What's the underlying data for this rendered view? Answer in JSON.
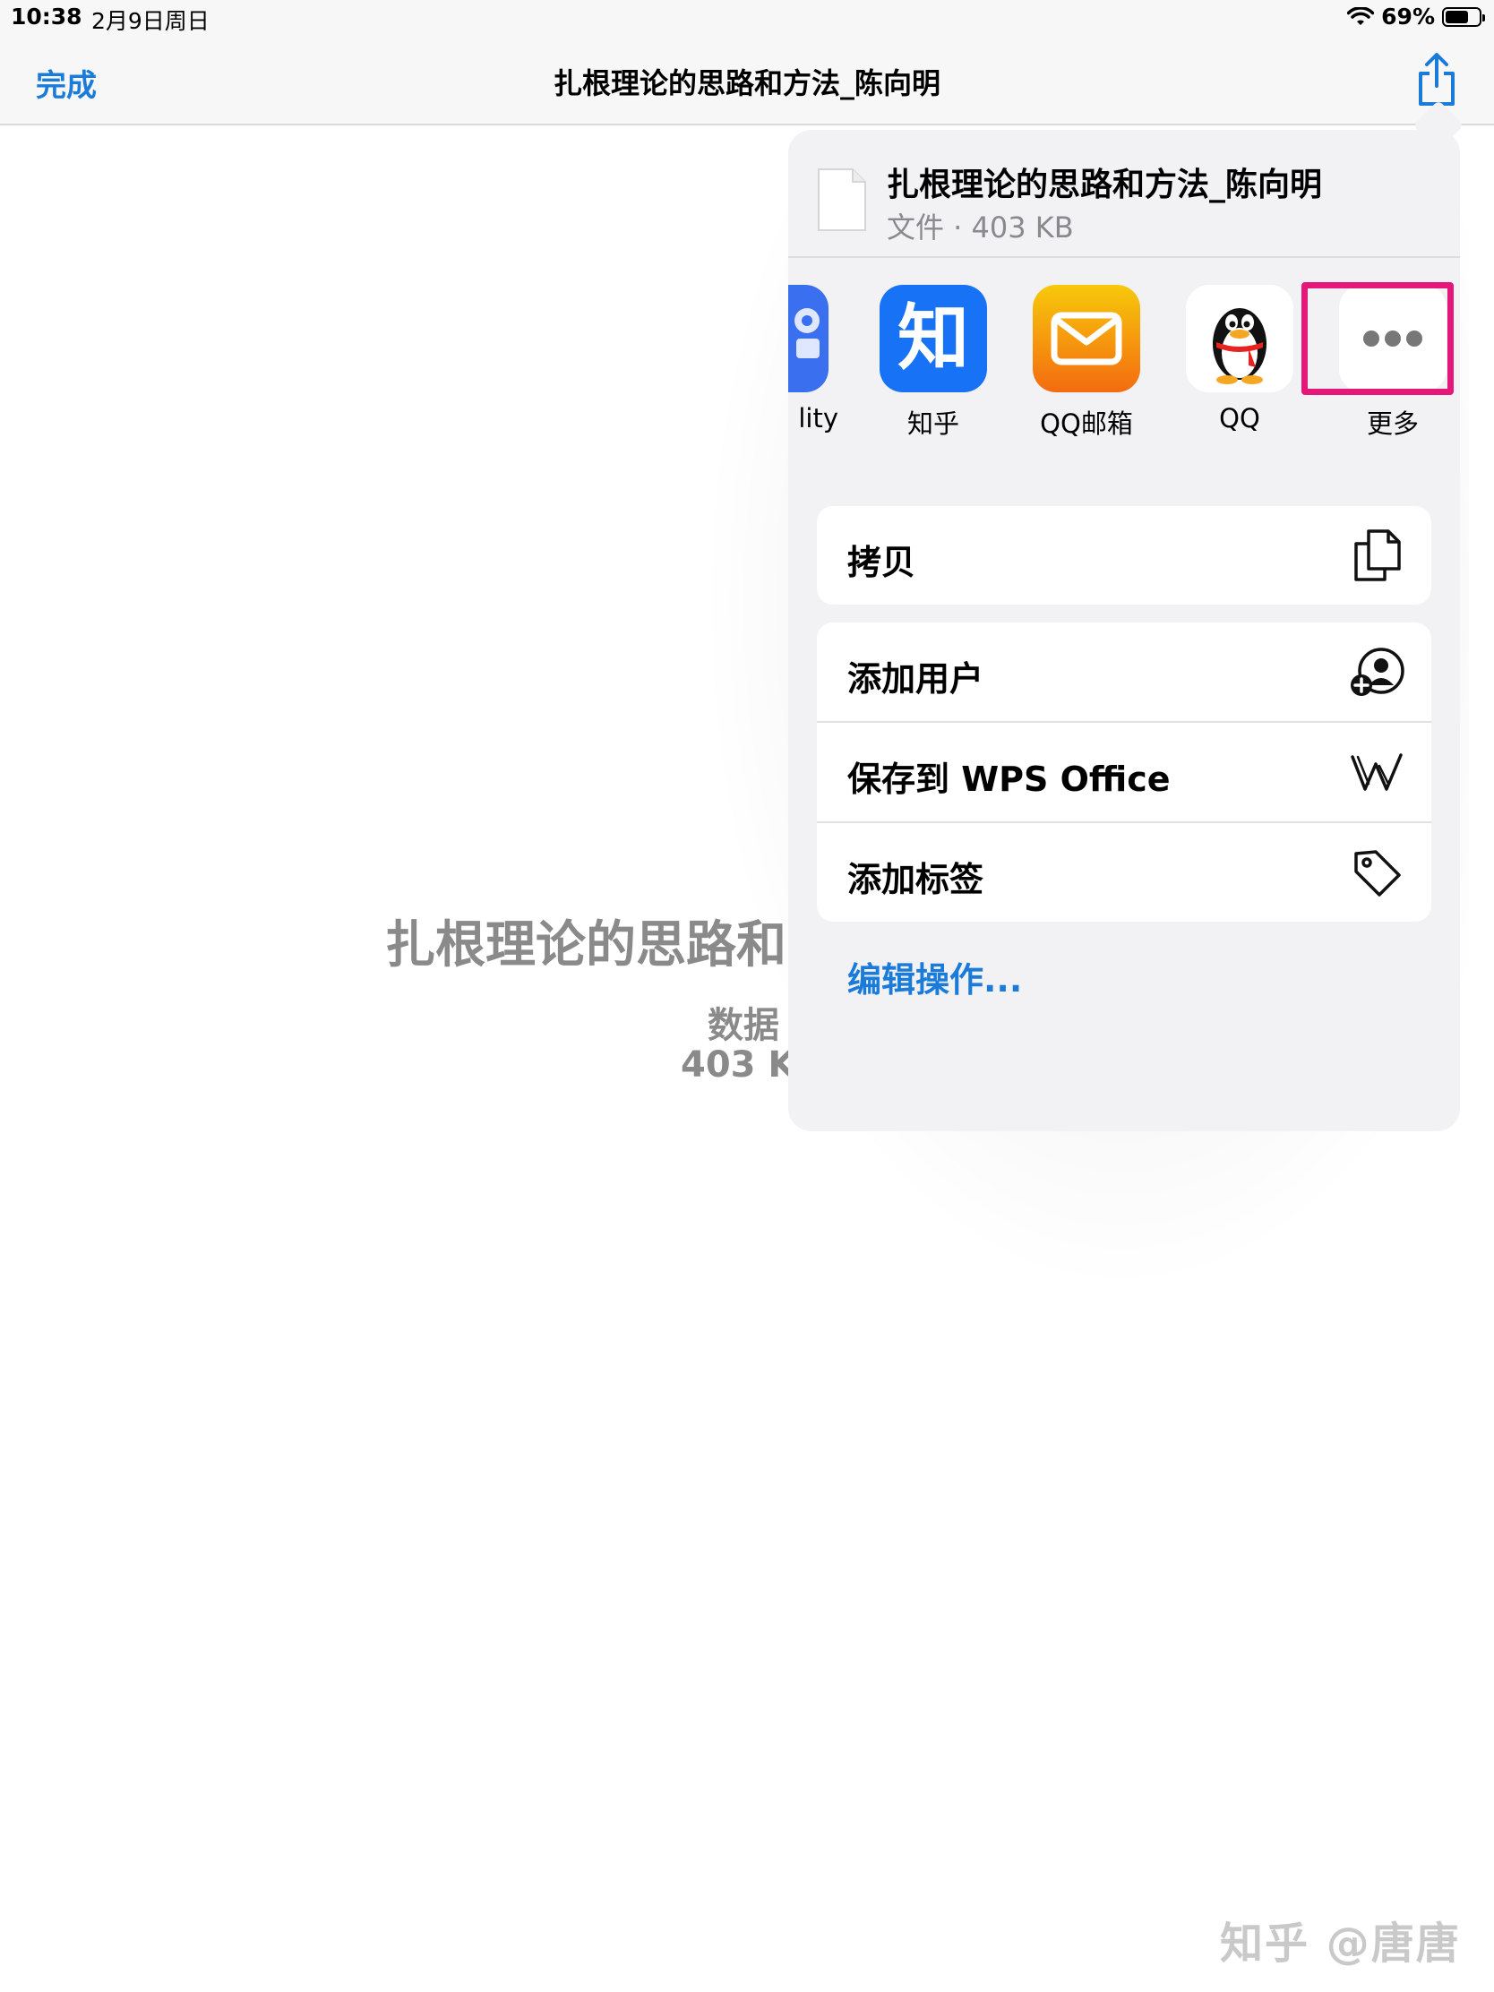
{
  "status_bar": {
    "time": "10:38",
    "date": "2月9日周日",
    "battery": "69%",
    "battery_level": 0.69
  },
  "nav": {
    "done_label": "完成",
    "title": "扎根理论的思路和方法_陈向明"
  },
  "document": {
    "title": "扎根理论的思路和",
    "kind": "数据",
    "size": "403 K"
  },
  "share_sheet": {
    "file_name": "扎根理论的思路和方法_陈向明",
    "file_meta": "文件 · 403 KB",
    "apps": [
      {
        "label": "lity",
        "icon": "partial-app-icon"
      },
      {
        "label": "知乎",
        "icon": "zhihu-icon",
        "glyph": "知"
      },
      {
        "label": "QQ邮箱",
        "icon": "qq-mail-icon"
      },
      {
        "label": "QQ",
        "icon": "qq-penguin-icon"
      },
      {
        "label": "更多",
        "icon": "more-icon"
      }
    ],
    "actions_primary": [
      {
        "label": "拷贝",
        "icon": "copy-icon"
      }
    ],
    "actions_secondary": [
      {
        "label": "添加用户",
        "icon": "add-person-icon"
      },
      {
        "label": "保存到 WPS Office",
        "icon": "wps-icon"
      },
      {
        "label": "添加标签",
        "icon": "tag-icon"
      }
    ],
    "edit_actions_label": "编辑操作..."
  },
  "colors": {
    "accent": "#1a7bd9",
    "highlight": "#e5187a",
    "zhihu": "#1772f6",
    "qqmail_top": "#f7c90b",
    "qqmail_bottom": "#f46b10"
  },
  "watermark": "知乎 @唐唐"
}
